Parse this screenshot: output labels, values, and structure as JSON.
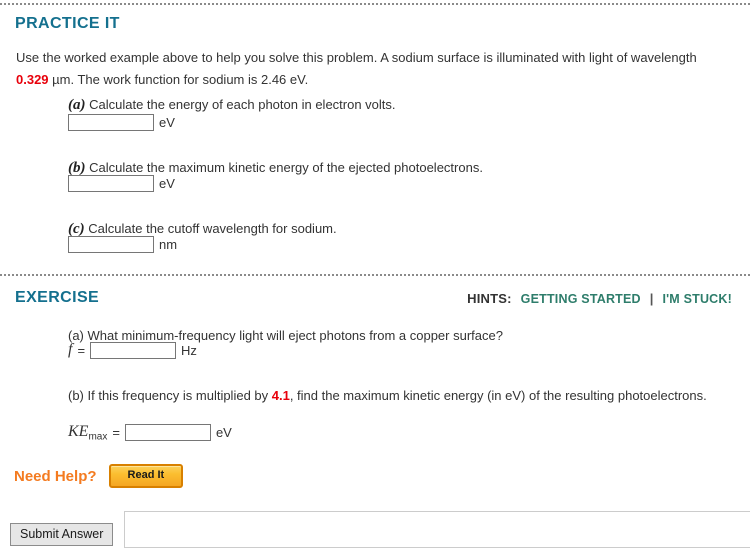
{
  "practice": {
    "title": "PRACTICE IT",
    "intro_before": "Use the worked example above to help you solve this problem. A sodium surface is illuminated with light of wavelength ",
    "intro_value": "0.329",
    "intro_after": " µm. The work function for sodium is 2.46 eV.",
    "parts": [
      {
        "label": "(a)",
        "text": " Calculate the energy of each photon in electron volts.",
        "input_value": "",
        "unit": "eV"
      },
      {
        "label": "(b)",
        "text": " Calculate the maximum kinetic energy of the ejected photoelectrons.",
        "input_value": "",
        "unit": "eV"
      },
      {
        "label": "(c)",
        "text": " Calculate the cutoff wavelength for sodium.",
        "input_value": "",
        "unit": "nm"
      }
    ]
  },
  "exercise": {
    "title": "EXERCISE",
    "hints": {
      "label": "HINTS:",
      "getting_started": "GETTING STARTED",
      "separator": "|",
      "im_stuck": "I'M STUCK!",
      "link_color": "#2e7d6b"
    },
    "part_a": {
      "text": "(a) What minimum-frequency light will eject photons from a copper surface?",
      "symbol": "f",
      "equals": "=",
      "input_value": "",
      "unit": "Hz"
    },
    "part_b": {
      "text_before": "(b) If this frequency is multiplied by ",
      "value": "4.1",
      "text_after": ", find the maximum kinetic energy (in eV) of the resulting photoelectrons.",
      "symbol": "KE",
      "subscript": "max",
      "equals": "=",
      "input_value": "",
      "unit": "eV"
    }
  },
  "help": {
    "label": "Need Help?",
    "read_it_label": "Read It",
    "label_color": "#f47b20"
  },
  "footer": {
    "submit_label": "Submit Answer"
  },
  "theme": {
    "heading_color": "#14708e",
    "highlight_color": "#e8000b",
    "accent_orange": "#f5a623"
  }
}
